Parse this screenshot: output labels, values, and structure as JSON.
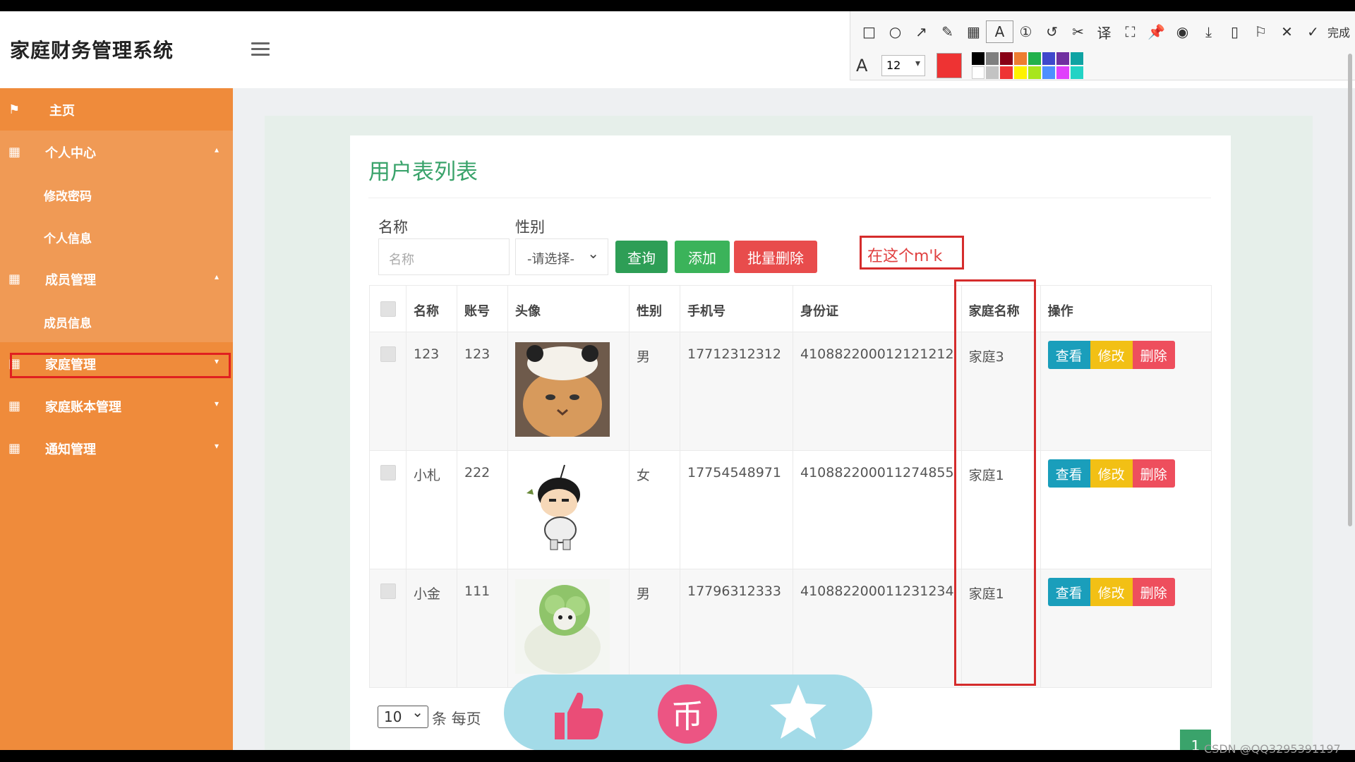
{
  "app": {
    "title": "家庭财务管理系统",
    "avatar_label": "80x80"
  },
  "annotation_toolbar": {
    "tools": [
      {
        "name": "rectangle-tool-icon",
        "glyph": "□"
      },
      {
        "name": "ellipse-tool-icon",
        "glyph": "○"
      },
      {
        "name": "arrow-tool-icon",
        "glyph": "↗"
      },
      {
        "name": "pencil-tool-icon",
        "glyph": "✎"
      },
      {
        "name": "mosaic-tool-icon",
        "glyph": "▦"
      },
      {
        "name": "text-tool-icon",
        "glyph": "A"
      },
      {
        "name": "number-tool-icon",
        "glyph": "①"
      },
      {
        "name": "undo-icon",
        "glyph": "↺"
      },
      {
        "name": "cut-icon",
        "glyph": "✂"
      },
      {
        "name": "translate-icon",
        "glyph": "译"
      },
      {
        "name": "screenshot-icon",
        "glyph": "⛶"
      },
      {
        "name": "pin-icon",
        "glyph": "📌"
      },
      {
        "name": "record-icon",
        "glyph": "◉"
      },
      {
        "name": "download-icon",
        "glyph": "⤓"
      },
      {
        "name": "save-icon",
        "glyph": "▯"
      },
      {
        "name": "bookmark-icon",
        "glyph": "⚐"
      },
      {
        "name": "close-icon",
        "glyph": "✕"
      }
    ],
    "done_label": "完成",
    "font_size": "12",
    "current_color": "#ee3333",
    "palette": [
      "#000000",
      "#7f7f7f",
      "#880015",
      "#ed7d31",
      "#22b14c",
      "#3f48cc",
      "#7030a0",
      "#0fa3a3",
      "#ffffff",
      "#c3c3c3",
      "#ee3333",
      "#fff200",
      "#a8e61d",
      "#4d8fff",
      "#e040fb",
      "#22d3c5"
    ]
  },
  "sidebar": {
    "home": "主页",
    "personal_center": "个人中心",
    "change_password": "修改密码",
    "personal_info": "个人信息",
    "member_mgmt": "成员管理",
    "member_info": "成员信息",
    "family_mgmt": "家庭管理",
    "family_ledger_mgmt": "家庭账本管理",
    "notice_mgmt": "通知管理"
  },
  "page": {
    "title": "用户表列表",
    "filter_name_label": "名称",
    "filter_name_placeholder": "名称",
    "filter_gender_label": "性别",
    "filter_gender_value": "-请选择-",
    "btn_query": "查询",
    "btn_add": "添加",
    "btn_batch_delete": "批量删除",
    "annotation_text": "在这个m'k"
  },
  "table": {
    "headers": [
      "名称",
      "账号",
      "头像",
      "性别",
      "手机号",
      "身份证",
      "家庭名称",
      "操作"
    ],
    "rows": [
      {
        "name": "123",
        "account": "123",
        "gender": "男",
        "phone": "17712312312",
        "id_card": "410882200012121212",
        "family": "家庭3"
      },
      {
        "name": "小札",
        "account": "222",
        "gender": "女",
        "phone": "17754548971",
        "id_card": "410882200011274855",
        "family": "家庭1"
      },
      {
        "name": "小金",
        "account": "111",
        "gender": "男",
        "phone": "17796312333",
        "id_card": "410882200011231234",
        "family": "家庭1"
      }
    ],
    "actions": {
      "view": "查看",
      "edit": "修改",
      "delete": "删除"
    }
  },
  "pager": {
    "page_size": "10",
    "per_page_text": "条 每页",
    "current_page": "1"
  },
  "reaction_bar": {
    "coin_glyph": "币"
  },
  "watermark": "CSDN @QQ3295391197"
}
